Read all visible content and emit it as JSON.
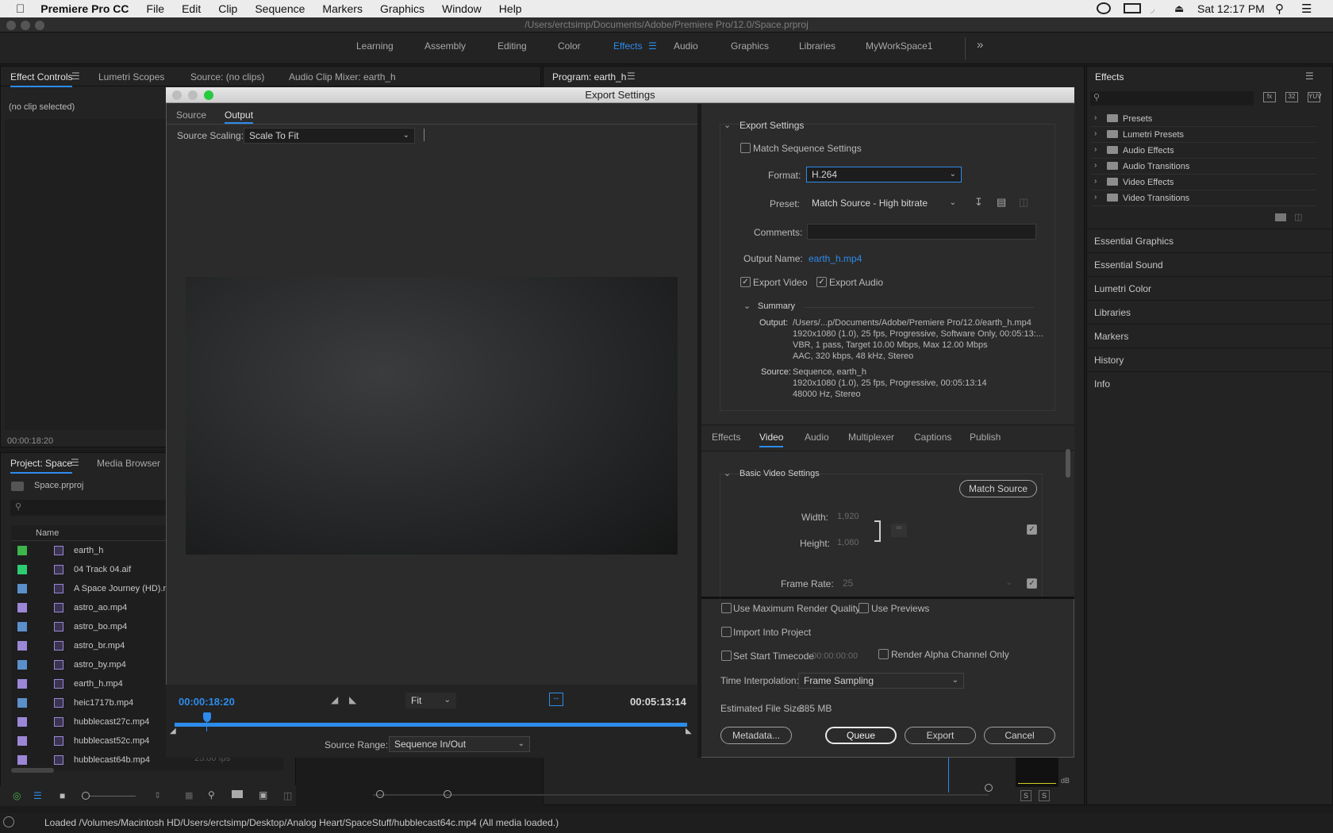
{
  "menubar": {
    "app": "Premiere Pro CC",
    "items": [
      "File",
      "Edit",
      "Clip",
      "Sequence",
      "Markers",
      "Graphics",
      "Window",
      "Help"
    ],
    "clock": "Sat 12:17 PM"
  },
  "title_path": "/Users/erctsimp/Documents/Adobe/Premiere Pro/12.0/Space.prproj",
  "workspaces": [
    "Learning",
    "Assembly",
    "Editing",
    "Color",
    "Effects",
    "Audio",
    "Graphics",
    "Libraries",
    "MyWorkSpace1"
  ],
  "active_workspace": "Effects",
  "top_tabs": {
    "effect_controls": "Effect Controls",
    "lumetri_scopes": "Lumetri Scopes",
    "source": "Source: (no clips)",
    "audio_mixer": "Audio Clip Mixer: earth_h",
    "program": "Program: earth_h"
  },
  "effect_controls": {
    "empty": "(no clip selected)",
    "timecode": "00:00:18:20"
  },
  "project": {
    "tab": "Project: Space",
    "media_browser": "Media Browser",
    "file": "Space.prproj",
    "col_name": "Name",
    "fps_fragment": "25.00 fps",
    "items": [
      {
        "name": "earth_h",
        "color": "#3cb54a"
      },
      {
        "name": "04 Track 04.aif",
        "color": "#2ecc71"
      },
      {
        "name": "A Space Journey (HD).m",
        "color": "#5b8fcb"
      },
      {
        "name": "astro_ao.mp4",
        "color": "#9b87d6"
      },
      {
        "name": "astro_bo.mp4",
        "color": "#5b8fcb"
      },
      {
        "name": "astro_br.mp4",
        "color": "#9b87d6"
      },
      {
        "name": "astro_by.mp4",
        "color": "#5b8fcb"
      },
      {
        "name": "earth_h.mp4",
        "color": "#9b87d6"
      },
      {
        "name": "heic1717b.mp4",
        "color": "#5b8fcb"
      },
      {
        "name": "hubblecast27c.mp4",
        "color": "#9b87d6"
      },
      {
        "name": "hubblecast52c.mp4",
        "color": "#9b87d6"
      },
      {
        "name": "hubblecast64b.mp4",
        "color": "#9b87d6"
      }
    ]
  },
  "dialog": {
    "title": "Export Settings",
    "tabs": {
      "source": "Source",
      "output": "Output"
    },
    "source_scaling_label": "Source Scaling:",
    "source_scaling": "Scale To Fit",
    "timecode_in": "00:00:18:20",
    "timecode_out": "00:05:13:14",
    "zoom": "Fit",
    "source_range_label": "Source Range:",
    "source_range": "Sequence In/Out",
    "export_settings": {
      "heading": "Export Settings",
      "match_seq": "Match Sequence Settings",
      "format_label": "Format:",
      "format": "H.264",
      "preset_label": "Preset:",
      "preset": "Match Source - High bitrate",
      "comments_label": "Comments:",
      "output_name_label": "Output Name:",
      "output_name": "earth_h.mp4",
      "export_video": "Export Video",
      "export_audio": "Export Audio"
    },
    "summary": {
      "heading": "Summary",
      "output_label": "Output:",
      "output_lines": [
        "/Users/...p/Documents/Adobe/Premiere Pro/12.0/earth_h.mp4",
        "1920x1080 (1.0), 25 fps, Progressive, Software Only, 00:05:13:...",
        "VBR, 1 pass, Target 10.00 Mbps, Max 12.00 Mbps",
        "AAC, 320 kbps, 48 kHz, Stereo"
      ],
      "source_label": "Source:",
      "source_lines": [
        "Sequence, earth_h",
        "1920x1080 (1.0), 25 fps, Progressive, 00:05:13:14",
        "48000 Hz, Stereo"
      ]
    },
    "sub_tabs": [
      "Effects",
      "Video",
      "Audio",
      "Multiplexer",
      "Captions",
      "Publish"
    ],
    "video": {
      "heading": "Basic Video Settings",
      "match_source": "Match Source",
      "width_label": "Width:",
      "width": "1,920",
      "height_label": "Height:",
      "height": "1,080",
      "frame_rate_label": "Frame Rate:",
      "frame_rate": "25"
    },
    "options": {
      "max_render": "Use Maximum Render Quality",
      "use_previews": "Use Previews",
      "import_project": "Import Into Project",
      "start_tc": "Set Start Timecode",
      "start_tc_value": "00:00:00:00",
      "render_alpha": "Render Alpha Channel Only",
      "time_interp_label": "Time Interpolation:",
      "time_interp": "Frame Sampling",
      "file_size_label": "Estimated File Size:",
      "file_size": "385 MB"
    },
    "buttons": {
      "metadata": "Metadata...",
      "queue": "Queue",
      "export": "Export",
      "cancel": "Cancel"
    }
  },
  "effects_panel": {
    "title": "Effects",
    "folders": [
      "Presets",
      "Lumetri Presets",
      "Audio Effects",
      "Audio Transitions",
      "Video Effects",
      "Video Transitions"
    ],
    "sections": [
      "Essential Graphics",
      "Essential Sound",
      "Lumetri Color",
      "Libraries",
      "Markers",
      "History",
      "Info"
    ]
  },
  "audio_meter": {
    "db": "dB",
    "s1": "S",
    "s2": "S"
  },
  "status": "Loaded /Volumes/Macintosh HD/Users/erctsimp/Desktop/Analog Heart/SpaceStuff/hubblecast64c.mp4 (All media loaded.)"
}
